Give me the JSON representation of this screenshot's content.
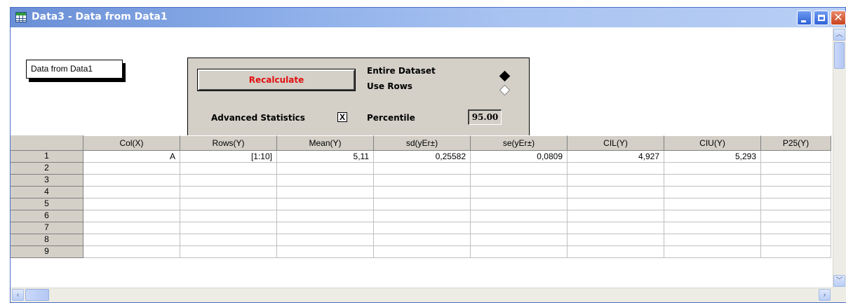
{
  "window": {
    "title": "Data3 - Data from Data1",
    "minimize_icon": "minimize-icon",
    "maximize_icon": "maximize-icon",
    "close_glyph": "✕"
  },
  "sheet_label": "Data from Data1",
  "panel": {
    "recalculate_label": "Recalculate",
    "entire_dataset_label": "Entire Dataset",
    "use_rows_label": "Use Rows",
    "advanced_statistics_label": "Advanced Statistics",
    "advanced_statistics_checked": "X",
    "percentile_label": "Percentile",
    "percentile_value": "95.00",
    "selected_range_mode": "Entire Dataset"
  },
  "columns": [
    "Col(X)",
    "Rows(Y)",
    "Mean(Y)",
    "sd(yEr±)",
    "se(yEr±)",
    "CIL(Y)",
    "CIU(Y)",
    "P25(Y)"
  ],
  "rows": [
    {
      "num": "1",
      "cells": [
        "A",
        "[1:10]",
        "5,11",
        "0,25582",
        "0,0809",
        "4,927",
        "5,293",
        ""
      ]
    },
    {
      "num": "2",
      "cells": [
        "",
        "",
        "",
        "",
        "",
        "",
        "",
        ""
      ]
    },
    {
      "num": "3",
      "cells": [
        "",
        "",
        "",
        "",
        "",
        "",
        "",
        ""
      ]
    },
    {
      "num": "4",
      "cells": [
        "",
        "",
        "",
        "",
        "",
        "",
        "",
        ""
      ]
    },
    {
      "num": "5",
      "cells": [
        "",
        "",
        "",
        "",
        "",
        "",
        "",
        ""
      ]
    },
    {
      "num": "6",
      "cells": [
        "",
        "",
        "",
        "",
        "",
        "",
        "",
        ""
      ]
    },
    {
      "num": "7",
      "cells": [
        "",
        "",
        "",
        "",
        "",
        "",
        "",
        ""
      ]
    },
    {
      "num": "8",
      "cells": [
        "",
        "",
        "",
        "",
        "",
        "",
        "",
        ""
      ]
    },
    {
      "num": "9",
      "cells": [
        "",
        "",
        "",
        "",
        "",
        "",
        "",
        ""
      ]
    }
  ],
  "colors": {
    "titlebar": "#6a8fd6",
    "recalculate_text": "#e01010",
    "panel_bg": "#d4d0c8"
  }
}
